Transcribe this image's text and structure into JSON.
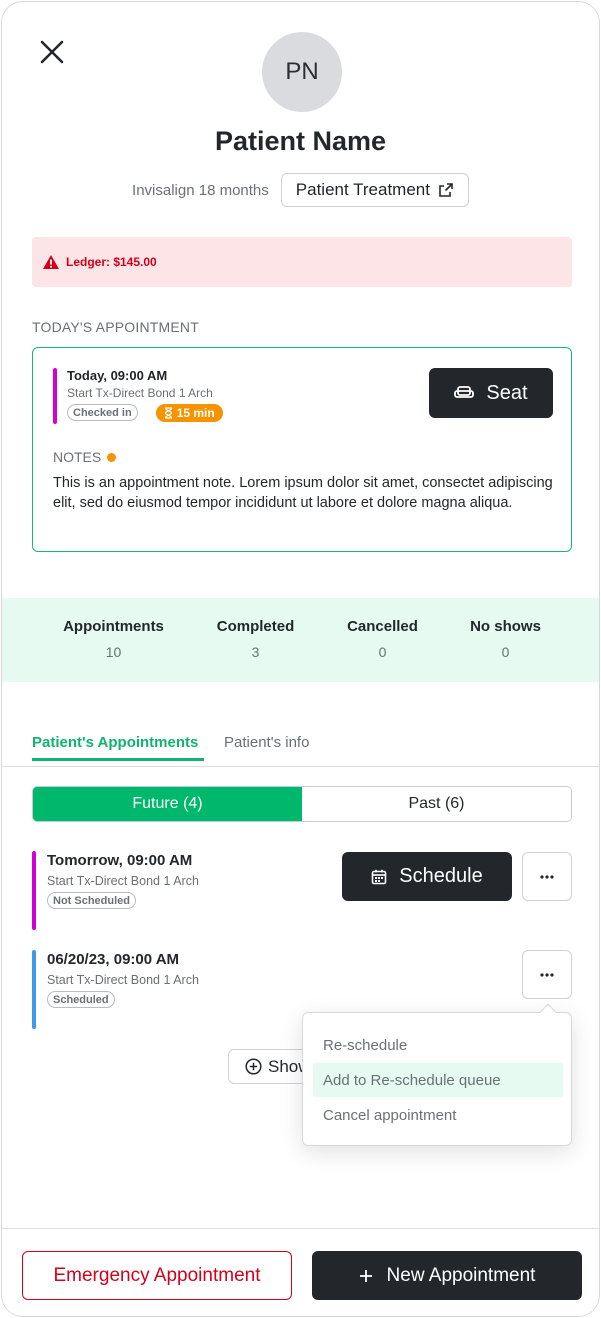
{
  "header": {
    "avatar_initials": "PN",
    "patient_name": "Patient Name",
    "plan": "Invisalign 18 months",
    "treatment_button": "Patient Treatment"
  },
  "ledger": {
    "text": "Ledger: $145.00"
  },
  "today": {
    "section_label": "TODAY'S APPOINTMENT",
    "time": "Today, 09:00 AM",
    "procedure": "Start Tx-Direct Bond 1 Arch",
    "status": "Checked in",
    "timer": "15 min",
    "seat_button": "Seat",
    "notes_label": "NOTES",
    "notes_text": "This is an appointment note. Lorem ipsum dolor sit amet, consectet adipiscing elit, sed do eiusmod tempor incididunt ut labore et dolore magna aliqua."
  },
  "stats": [
    {
      "label": "Appointments",
      "value": "10"
    },
    {
      "label": "Completed",
      "value": "3"
    },
    {
      "label": "Cancelled",
      "value": "0"
    },
    {
      "label": "No shows",
      "value": "0"
    }
  ],
  "tabs": {
    "active": "Patient's Appointments",
    "inactive": "Patient's info"
  },
  "segment": {
    "future": "Future (4)",
    "past": "Past (6)"
  },
  "appointments": [
    {
      "time": "Tomorrow, 09:00 AM",
      "procedure": "Start Tx-Direct Bond 1 Arch",
      "status": "Not Scheduled",
      "bar_color": "#d300d3"
    },
    {
      "time": "06/20/23, 09:00 AM",
      "procedure": "Start Tx-Direct Bond 1 Arch",
      "status": "Scheduled",
      "bar_color": "#3d9be9"
    }
  ],
  "schedule_button": "Schedule",
  "show_button": "Show",
  "menu": {
    "items": [
      "Re-schedule",
      "Add to Re-schedule queue",
      "Cancel appointment"
    ]
  },
  "footer": {
    "emergency": "Emergency Appointment",
    "new": "New Appointment"
  },
  "colors": {
    "accent": "#00b86b",
    "danger": "#d0021b",
    "warning": "#f59300",
    "dark": "#23272b"
  }
}
